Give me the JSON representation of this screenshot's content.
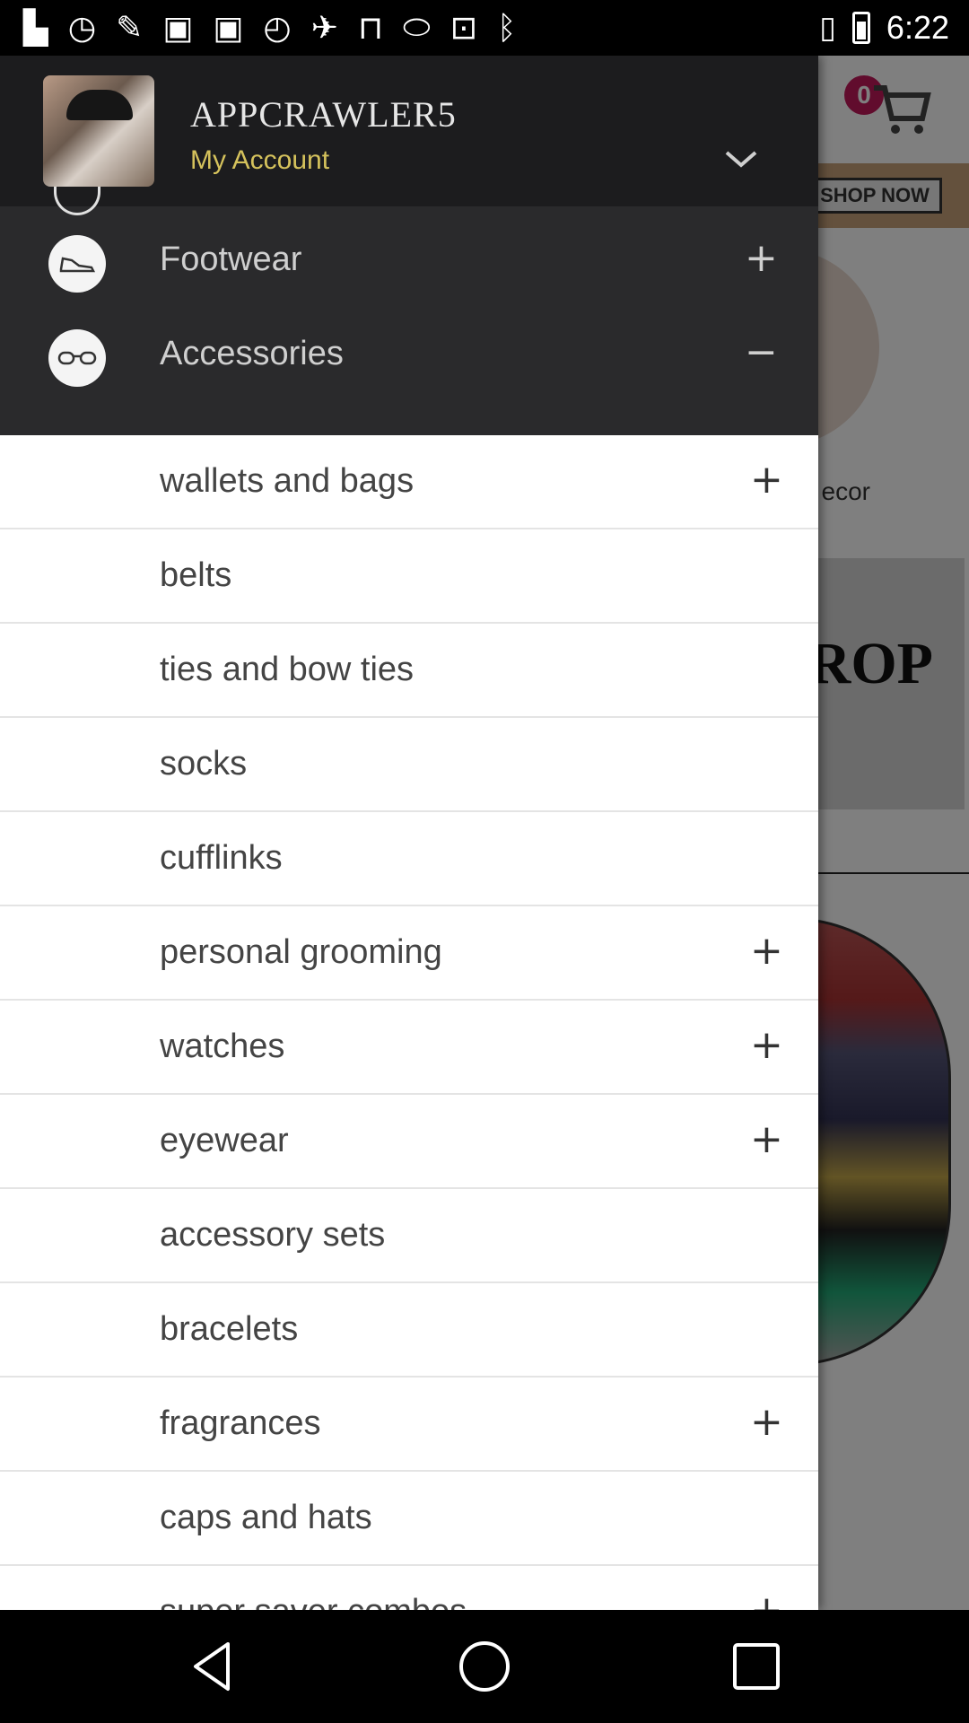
{
  "status_bar": {
    "time": "6:22",
    "left_icons": [
      "flipboard-icon",
      "alarm-icon",
      "wrench-icon",
      "nfc-icon",
      "nfc-icon",
      "speed-icon",
      "fake-gps-icon",
      "lock-icon",
      "toggle-icon",
      "inbox-icon",
      "bluetooth-icon"
    ],
    "right_icons": [
      "vibrate-icon",
      "battery-icon"
    ]
  },
  "header": {
    "username": "APPCRAWLER5",
    "account_label": "My Account"
  },
  "cart": {
    "count": "0"
  },
  "background": {
    "shop_now": "SHOP NOW",
    "decor_label": "ecor",
    "drop_text": "ROP"
  },
  "categories": [
    {
      "label": "Footwear",
      "icon": "shoe-icon",
      "action": "+"
    },
    {
      "label": "Accessories",
      "icon": "glasses-icon",
      "action": "−"
    }
  ],
  "subcategories": [
    {
      "label": "wallets and bags",
      "expand": "+"
    },
    {
      "label": "belts",
      "expand": ""
    },
    {
      "label": "ties and bow ties",
      "expand": ""
    },
    {
      "label": "socks",
      "expand": ""
    },
    {
      "label": "cufflinks",
      "expand": ""
    },
    {
      "label": "personal grooming",
      "expand": "+"
    },
    {
      "label": "watches",
      "expand": "+"
    },
    {
      "label": "eyewear",
      "expand": "+"
    },
    {
      "label": "accessory sets",
      "expand": ""
    },
    {
      "label": "bracelets",
      "expand": ""
    },
    {
      "label": "fragrances",
      "expand": "+"
    },
    {
      "label": "caps and hats",
      "expand": ""
    },
    {
      "label": "super saver combos",
      "expand": "+"
    }
  ],
  "colors": {
    "header_bg": "#1c1c1e",
    "category_bg": "#2a2a2c",
    "accent_account": "#d5c25c",
    "badge": "#c2185b"
  }
}
